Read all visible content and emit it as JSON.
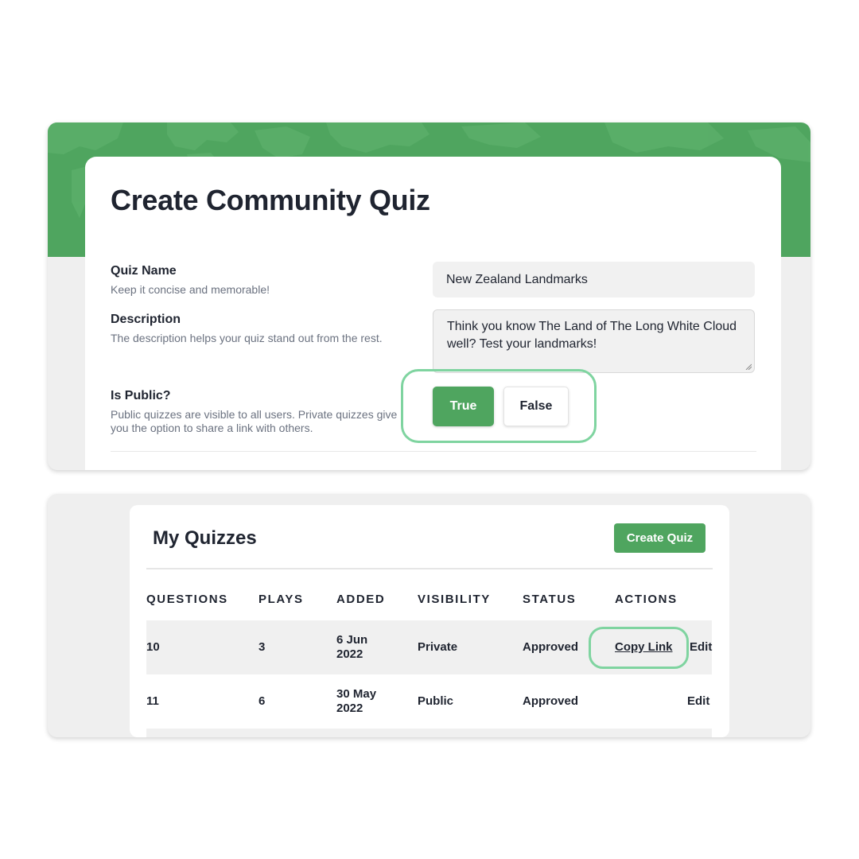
{
  "colors": {
    "accent": "#4fa55f",
    "highlight": "#7fd4a0",
    "text": "#1f2430",
    "muted": "#6b7280"
  },
  "create_form": {
    "title": "Create Community Quiz",
    "quiz_name": {
      "label": "Quiz Name",
      "help": "Keep it concise and memorable!",
      "value": "New Zealand Landmarks"
    },
    "description": {
      "label": "Description",
      "help": "The description helps your quiz stand out from the rest.",
      "value": "Think you know The Land of The Long White Cloud well? Test your landmarks!"
    },
    "is_public": {
      "label": "Is Public?",
      "help": "Public quizzes are visible to all users. Private quizzes give you the option to share a link with others.",
      "true_label": "True",
      "false_label": "False",
      "selected": "True"
    }
  },
  "my_quizzes": {
    "title": "My Quizzes",
    "create_button": "Create Quiz",
    "columns": [
      "QUESTIONS",
      "PLAYS",
      "ADDED",
      "VISIBILITY",
      "STATUS",
      "ACTIONS"
    ],
    "rows": [
      {
        "questions": "10",
        "plays": "3",
        "added_line1": "6 Jun",
        "added_line2": "2022",
        "visibility": "Private",
        "status": "Approved",
        "copy_link": "Copy Link",
        "edit": "Edit"
      },
      {
        "questions": "11",
        "plays": "6",
        "added_line1": "30 May",
        "added_line2": "2022",
        "visibility": "Public",
        "status": "Approved",
        "edit": "Edit"
      }
    ]
  }
}
